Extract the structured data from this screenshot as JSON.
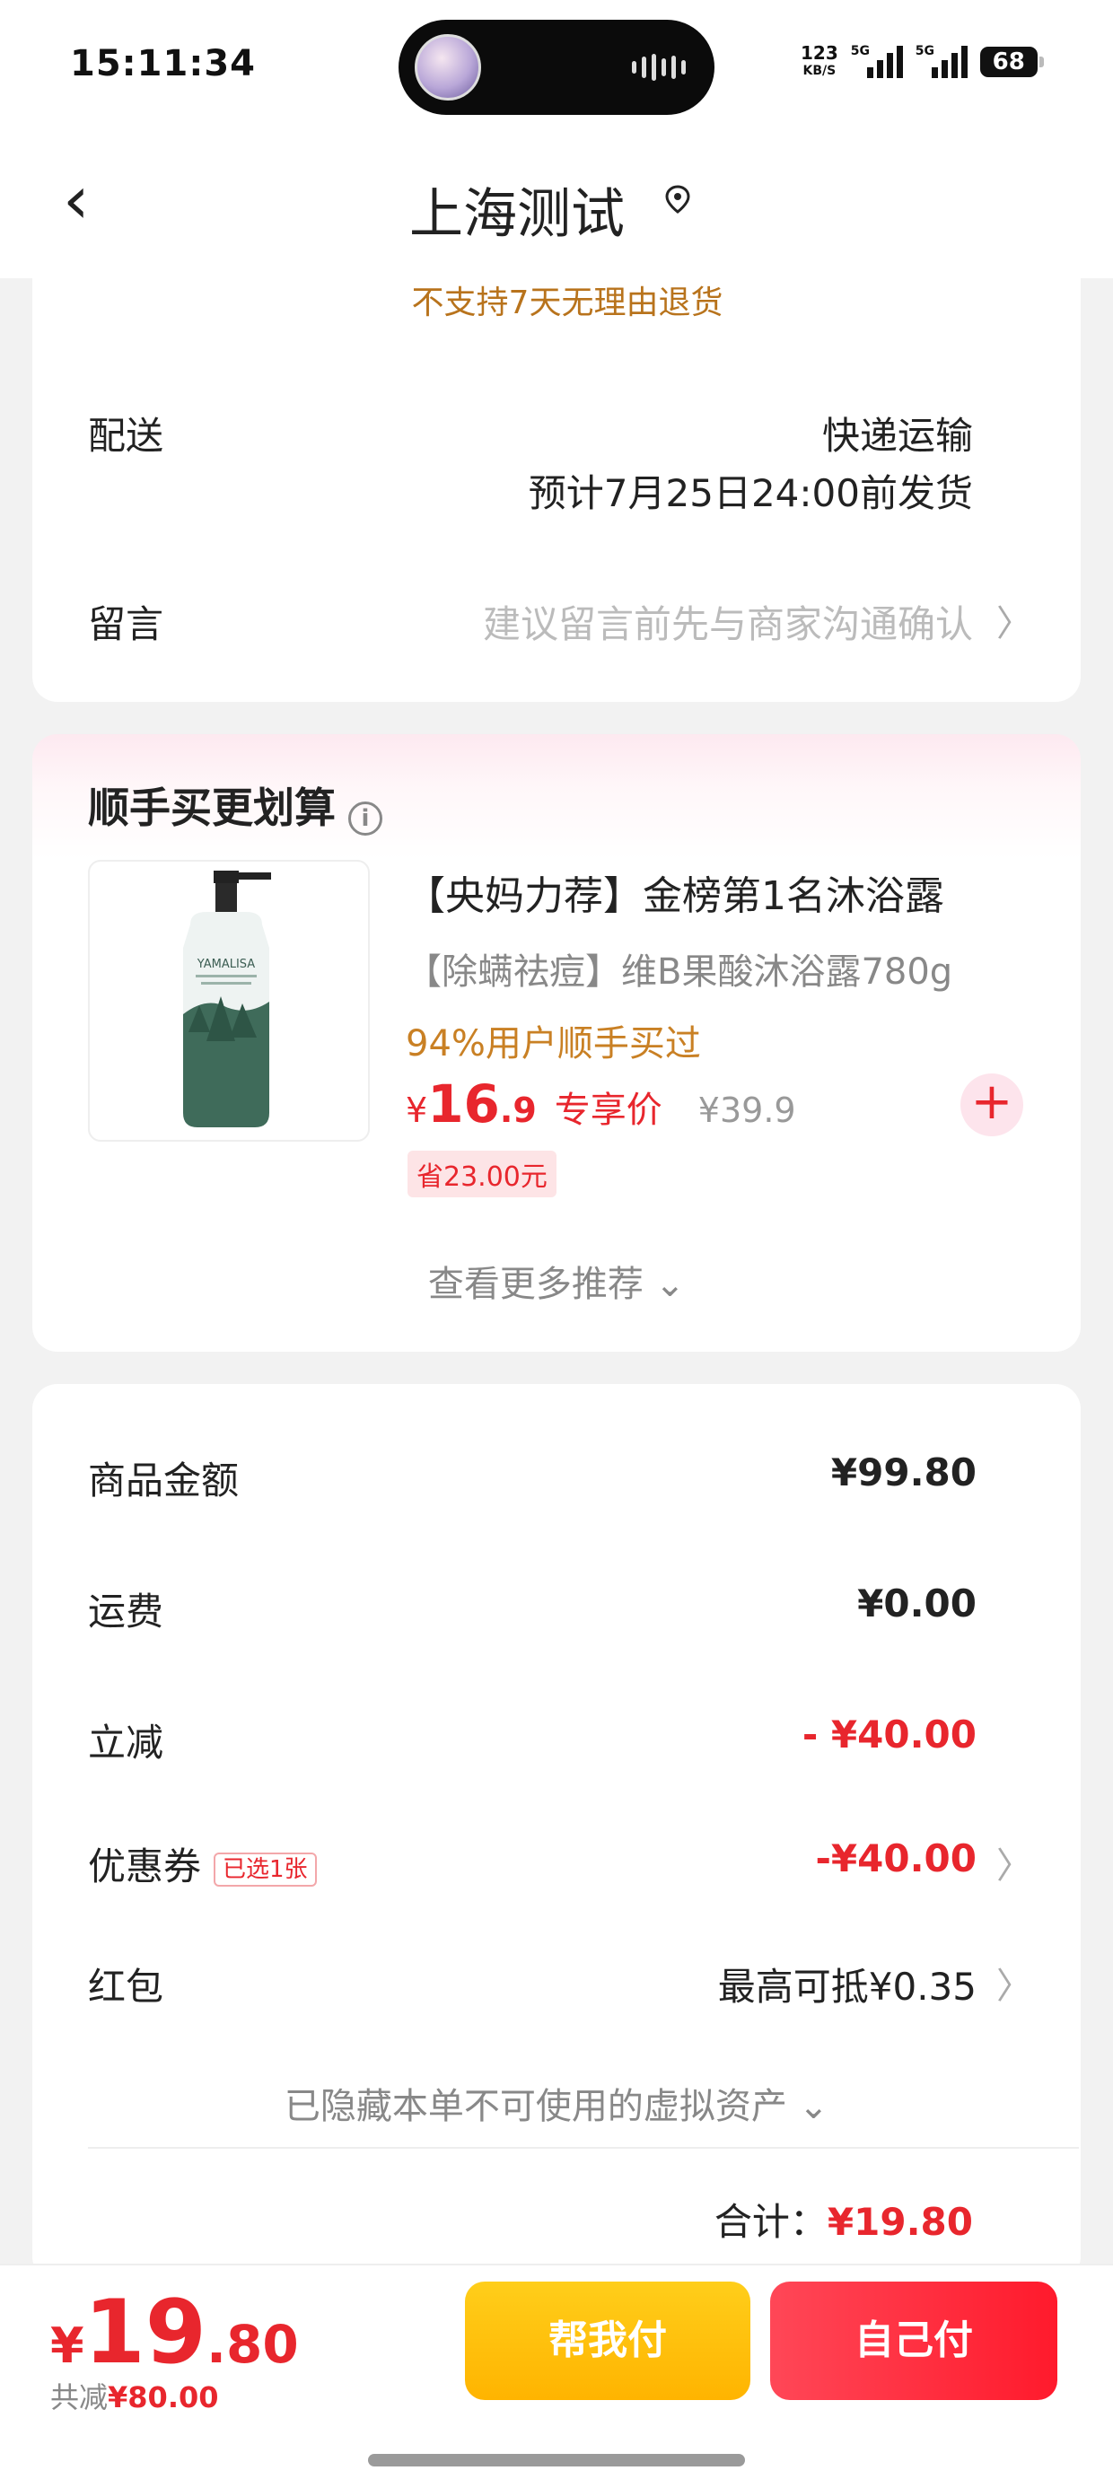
{
  "status_bar": {
    "time": "15:11:34",
    "net_speed": "123",
    "net_unit": "KB/S",
    "sim1": "5G",
    "sim2": "5G",
    "battery": "68"
  },
  "header": {
    "title": "上海测试",
    "icons": {
      "back": "chevron-left-icon",
      "location": "location-pin-icon"
    }
  },
  "shipping": {
    "notice": "不支持7天无理由退货",
    "delivery_label": "配送",
    "delivery_method": "快递运输",
    "delivery_eta": "预计7月25日24:00前发货",
    "message_label": "留言",
    "message_placeholder": "建议留言前先与商家沟通确认",
    "message_chevron": "〉"
  },
  "recommend": {
    "title": "顺手买更划算",
    "info_icon": "i",
    "product": {
      "name": "【央妈力荐】金榜第1名沐浴露",
      "subtitle": "【除螨祛痘】维B果酸沐浴露780g",
      "social_proof": "94%用户顺手买过",
      "currency": "¥",
      "price_int": "16",
      "price_dec": ".9",
      "price_tag": "专享价",
      "original_price": "¥39.9",
      "saving": "省23.00元",
      "add_symbol": "+",
      "image_brand": "YAMALISA"
    },
    "more": "查看更多推荐 ⌄"
  },
  "summary": {
    "goods_label": "商品金额",
    "goods_value": "¥99.80",
    "shipping_label": "运费",
    "shipping_value": "¥0.00",
    "discount_label": "立减",
    "discount_value": "- ¥40.00",
    "coupon_label": "优惠券",
    "coupon_tag": "已选1张",
    "coupon_value": "-¥40.00",
    "redpacket_label": "红包",
    "redpacket_value": "最高可抵¥0.35",
    "chevron": "〉",
    "hidden_assets": "已隐藏本单不可使用的虚拟资产 ⌄",
    "total_label": "合计：",
    "total_value": "¥19.80"
  },
  "bottom": {
    "currency": "¥",
    "price_int": "19",
    "price_dec": ".80",
    "saved_label": "共减",
    "saved_value": "¥80.00",
    "help_pay": "帮我付",
    "self_pay": "自己付"
  },
  "colors": {
    "accent_red": "#e8262d",
    "notice_orange": "#b8731c",
    "help_button": "#ffb400",
    "self_button": "#ff1a2c"
  }
}
